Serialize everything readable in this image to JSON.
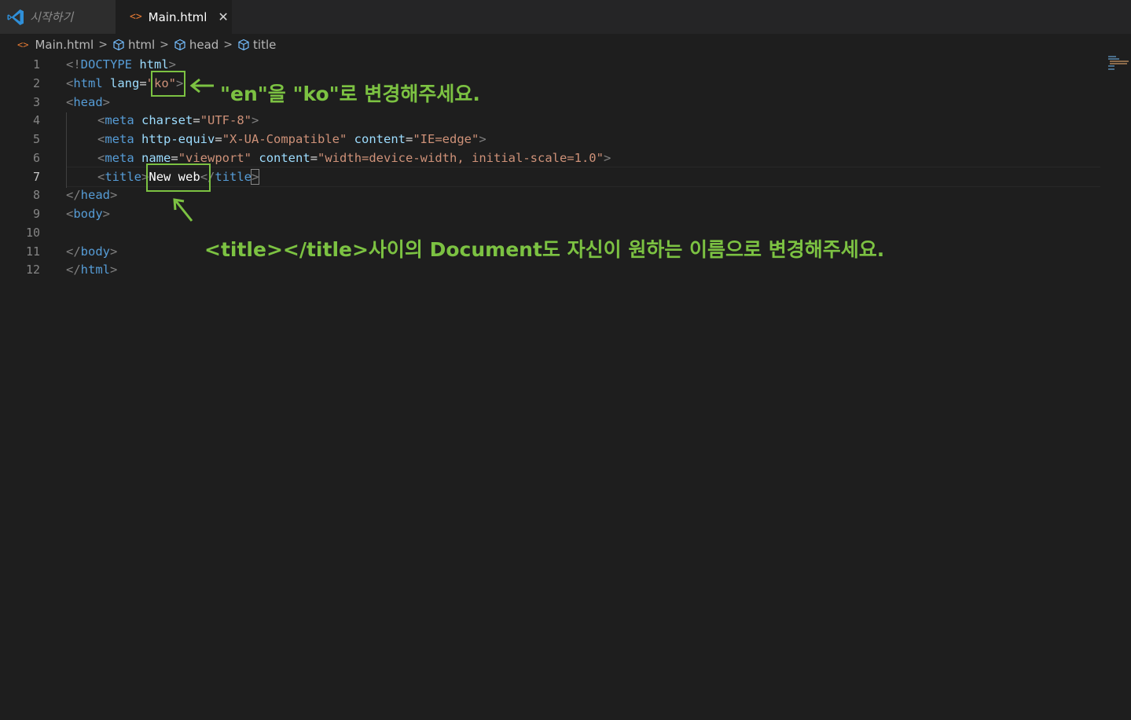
{
  "tabs": [
    {
      "label": "시작하기",
      "icon": "vscode-logo-icon"
    },
    {
      "label": "Main.html",
      "icon": "html-file-icon",
      "close": "✕"
    }
  ],
  "breadcrumb": {
    "file": "Main.html",
    "items": [
      "html",
      "head",
      "title"
    ]
  },
  "editor": {
    "line_numbers": [
      "1",
      "2",
      "3",
      "4",
      "5",
      "6",
      "7",
      "8",
      "9",
      "10",
      "11",
      "12"
    ],
    "active_line": 7,
    "lines": {
      "l1": {
        "p1": "<!",
        "tag": "DOCTYPE",
        "sp": " ",
        "attr": "html",
        "p2": ">"
      },
      "l2": {
        "p1": "<",
        "tag": "html",
        "sp": " ",
        "attr": "lang",
        "eq": "=",
        "val": "\"ko\"",
        "p2": ">"
      },
      "l3": {
        "p1": "<",
        "tag": "head",
        "p2": ">"
      },
      "l4": {
        "p1": "<",
        "tag": "meta",
        "sp": " ",
        "attr": "charset",
        "eq": "=",
        "val": "\"UTF-8\"",
        "p2": ">"
      },
      "l5": {
        "p1": "<",
        "tag": "meta",
        "sp": " ",
        "attr1": "http-equiv",
        "eq1": "=",
        "val1": "\"X-UA-Compatible\"",
        "sp2": " ",
        "attr2": "content",
        "eq2": "=",
        "val2": "\"IE=edge\"",
        "p2": ">"
      },
      "l6": {
        "p1": "<",
        "tag": "meta",
        "sp": " ",
        "attr1": "name",
        "eq1": "=",
        "val1": "\"viewport\"",
        "sp2": " ",
        "attr2": "content",
        "eq2": "=",
        "val2": "\"width=device-width, initial-scale=1.0\"",
        "p2": ">"
      },
      "l7": {
        "p1": "<",
        "tag": "title",
        "p2": ">",
        "text": "New web",
        "p3": "</",
        "tag2": "title",
        "p4": ">"
      },
      "l8": {
        "p1": "</",
        "tag": "head",
        "p2": ">"
      },
      "l9": {
        "p1": "<",
        "tag": "body",
        "p2": ">"
      },
      "l11": {
        "p1": "</",
        "tag": "body",
        "p2": ">"
      },
      "l12": {
        "p1": "</",
        "tag": "html",
        "p2": ">"
      }
    }
  },
  "annotations": {
    "note1": "\"en\"을 \"ko\"로 변경해주세요.",
    "note2": "<title></title>사이의 Document도 자신이 원하는 이름으로 변경해주세요.",
    "color": "#7cc242"
  }
}
